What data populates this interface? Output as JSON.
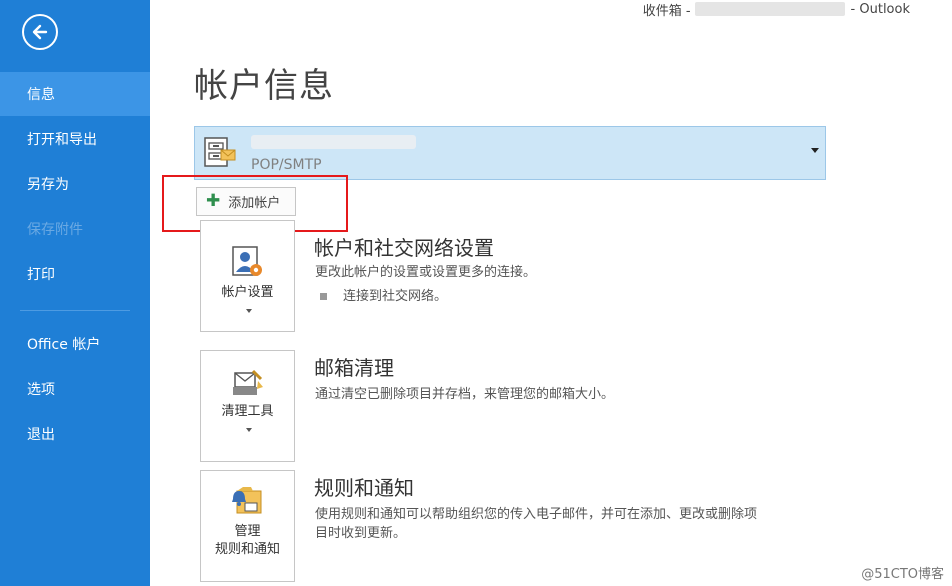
{
  "window_title": {
    "prefix": "收件箱 - ",
    "suffix": "- Outlook"
  },
  "sidebar": {
    "items": [
      {
        "label": "信息"
      },
      {
        "label": "打开和导出"
      },
      {
        "label": "另存为"
      },
      {
        "label": "保存附件"
      },
      {
        "label": "打印"
      },
      {
        "label": "Office 帐户"
      },
      {
        "label": "选项"
      },
      {
        "label": "退出"
      }
    ]
  },
  "main": {
    "title": "帐户信息",
    "account": {
      "type": "POP/SMTP"
    },
    "add_account_label": "添加帐户",
    "sections": [
      {
        "tile_label": "帐户设置",
        "title": "帐户和社交网络设置",
        "desc": "更改此帐户的设置或设置更多的连接。",
        "bullet": "连接到社交网络。"
      },
      {
        "tile_label": "清理工具",
        "title": "邮箱清理",
        "desc": "通过清空已删除项目并存档，来管理您的邮箱大小。"
      },
      {
        "tile_label_line1": "管理",
        "tile_label_line2": "规则和通知",
        "title": "规则和通知",
        "desc_line1": "使用规则和通知可以帮助组织您的传入电子邮件，并可在添加、更改或删除项",
        "desc_line2": "目时收到更新。"
      }
    ]
  },
  "watermark": "@51CTO博客",
  "colors": {
    "sidebar": "#1f7fd6",
    "sidebar_active": "#3c95e6",
    "account_bg": "#cde6f7",
    "highlight": "#e5191b"
  },
  "icons": [
    "back-arrow-icon",
    "account-card-icon",
    "dropdown-arrow-icon",
    "plus-icon",
    "account-settings-icon",
    "cleanup-tools-icon",
    "rules-alerts-icon"
  ]
}
